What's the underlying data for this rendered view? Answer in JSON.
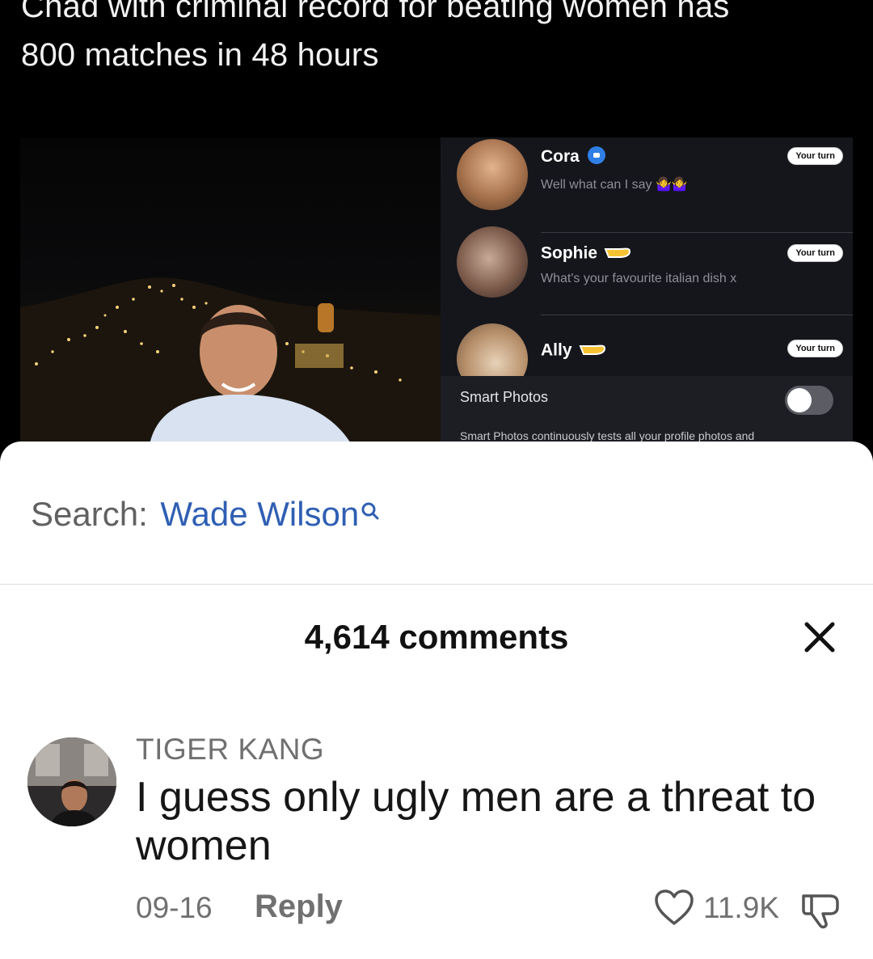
{
  "video": {
    "caption_line1": "Chad with criminal record for beating women has",
    "caption_line2": "800 matches in 48 hours",
    "chats": [
      {
        "name": "Cora",
        "preview": "Well what can I say 🤷‍♀️🤷‍♀️",
        "badge": "Your turn"
      },
      {
        "name": "Sophie",
        "preview": "What's your favourite italian dish x",
        "badge": "Your turn"
      },
      {
        "name": "Ally",
        "preview": "",
        "badge": "Your turn"
      }
    ],
    "smart_photos_label": "Smart Photos",
    "smart_photos_desc": "Smart Photos continuously tests all your profile photos and"
  },
  "search": {
    "prefix": "Search:",
    "query": "Wade Wilson"
  },
  "comments_header": {
    "title": "4,614 comments"
  },
  "comment": {
    "username": "TIGER KANG",
    "text": "I guess only ugly men are a threat to women",
    "date": "09-16",
    "reply_label": "Reply",
    "like_count": "11.9K"
  },
  "colors": {
    "search_query": "#2f5fb3",
    "sheet_bg": "#ffffff",
    "muted_text": "#707070"
  }
}
